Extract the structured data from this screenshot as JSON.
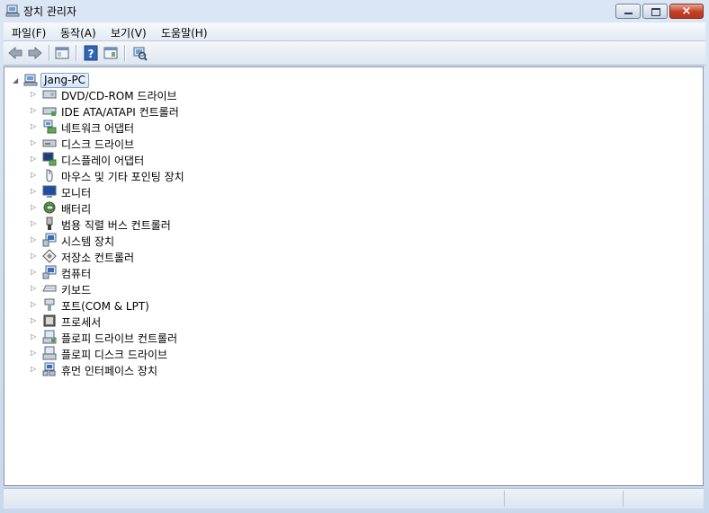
{
  "window": {
    "title": "장치 관리자",
    "icon": "device-manager-icon",
    "buttons": {
      "minimize": "minimize-icon",
      "maximize": "maximize-icon",
      "close": "×"
    }
  },
  "menu": [
    {
      "label": "파일(F)"
    },
    {
      "label": "동작(A)"
    },
    {
      "label": "보기(V)"
    },
    {
      "label": "도움말(H)"
    }
  ],
  "toolbar": [
    "back-arrow-icon",
    "forward-arrow-icon",
    "properties-icon",
    "help-icon",
    "console-tree-icon",
    "scan-hardware-icon"
  ],
  "tree": {
    "root": "Jang-PC",
    "items": [
      {
        "label": "DVD/CD-ROM 드라이브",
        "icon": "dvd-drive-icon"
      },
      {
        "label": "IDE ATA/ATAPI 컨트롤러",
        "icon": "ide-controller-icon"
      },
      {
        "label": "네트워크 어댑터",
        "icon": "network-adapter-icon"
      },
      {
        "label": "디스크 드라이브",
        "icon": "disk-drive-icon"
      },
      {
        "label": "디스플레이 어댑터",
        "icon": "display-adapter-icon"
      },
      {
        "label": "마우스 및 기타 포인팅 장치",
        "icon": "mouse-icon"
      },
      {
        "label": "모니터",
        "icon": "monitor-icon"
      },
      {
        "label": "배터리",
        "icon": "battery-icon"
      },
      {
        "label": "범용 직렬 버스 컨트롤러",
        "icon": "usb-icon"
      },
      {
        "label": "시스템 장치",
        "icon": "system-device-icon"
      },
      {
        "label": "저장소 컨트롤러",
        "icon": "storage-controller-icon"
      },
      {
        "label": "컴퓨터",
        "icon": "computer-icon"
      },
      {
        "label": "키보드",
        "icon": "keyboard-icon"
      },
      {
        "label": "포트(COM & LPT)",
        "icon": "port-icon"
      },
      {
        "label": "프로세서",
        "icon": "processor-icon"
      },
      {
        "label": "플로피 드라이브 컨트롤러",
        "icon": "floppy-controller-icon"
      },
      {
        "label": "플로피 디스크 드라이브",
        "icon": "floppy-drive-icon"
      },
      {
        "label": "휴먼 인터페이스 장치",
        "icon": "hid-icon"
      }
    ]
  },
  "colors": {
    "accent": "#7da2ce",
    "close": "#c23f24"
  }
}
